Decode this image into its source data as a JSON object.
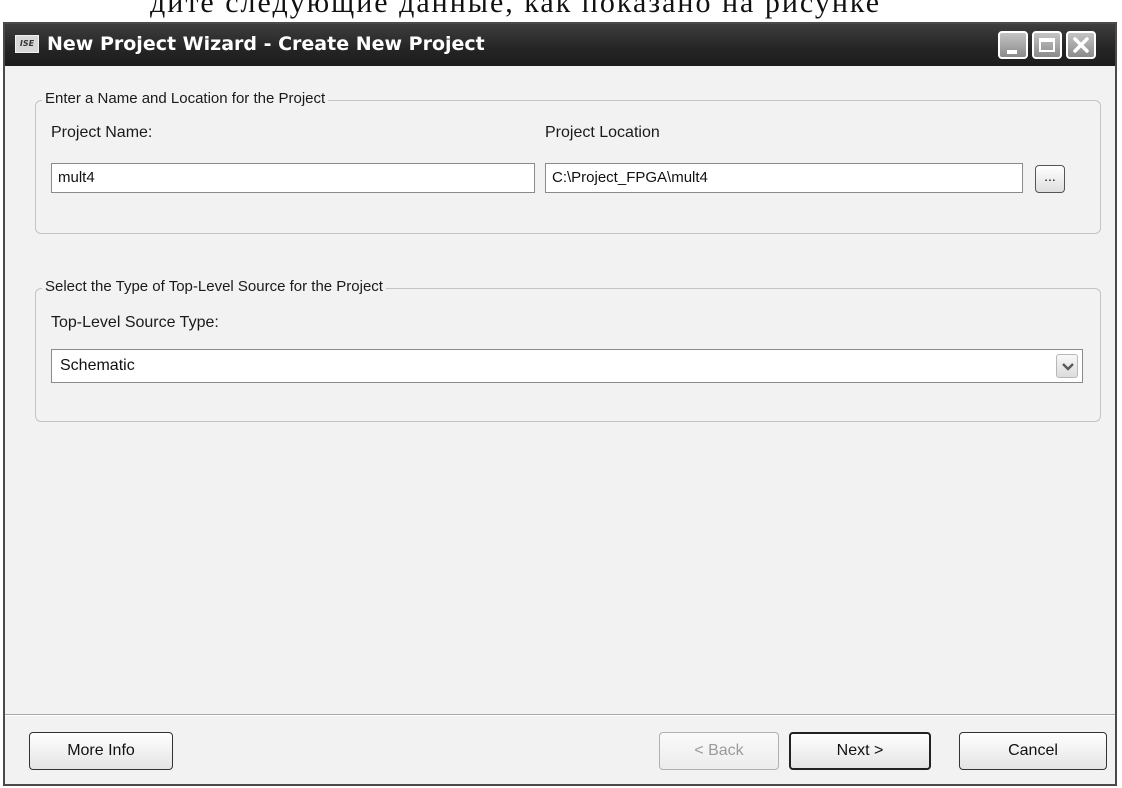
{
  "page_top_text": "дите следующие данные, как показано на рисунке",
  "window": {
    "title": "New Project Wizard - Create New Project",
    "icon_label": "ISE",
    "icon_name": "ise-app-icon"
  },
  "name_location_group": {
    "legend": "Enter a Name and Location for the Project",
    "project_name_label": "Project Name:",
    "project_name_value": "mult4",
    "project_location_label": "Project Location",
    "project_location_value": "C:\\Project_FPGA\\mult4",
    "browse_label": "..."
  },
  "source_type_group": {
    "legend": "Select the Type of Top-Level Source for the Project",
    "source_type_label": "Top-Level Source Type:",
    "source_type_value": "Schematic"
  },
  "footer": {
    "more_info_label": "More Info",
    "back_label": "< Back",
    "next_label": "Next >",
    "cancel_label": "Cancel"
  }
}
